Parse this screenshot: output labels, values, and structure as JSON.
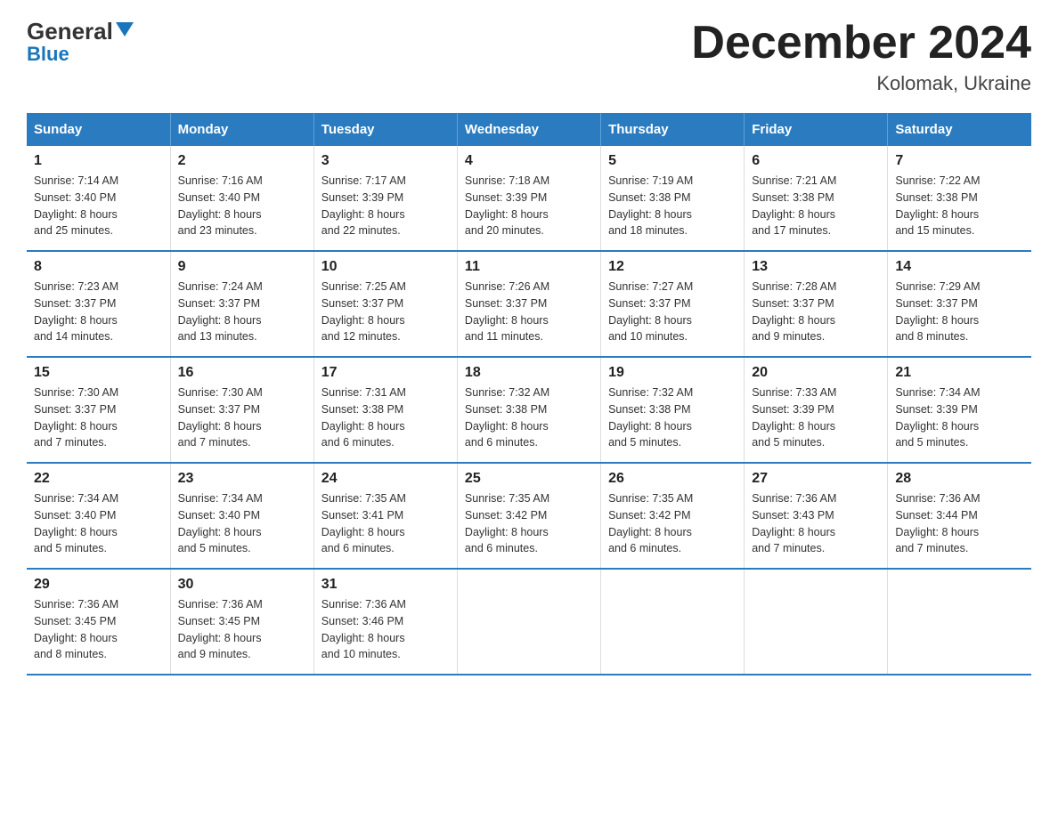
{
  "logo": {
    "text1": "General",
    "text2": "Blue"
  },
  "title": "December 2024",
  "subtitle": "Kolomak, Ukraine",
  "weekdays": [
    "Sunday",
    "Monday",
    "Tuesday",
    "Wednesday",
    "Thursday",
    "Friday",
    "Saturday"
  ],
  "weeks": [
    [
      {
        "day": "1",
        "sunrise": "7:14 AM",
        "sunset": "3:40 PM",
        "daylight": "8 hours and 25 minutes."
      },
      {
        "day": "2",
        "sunrise": "7:16 AM",
        "sunset": "3:40 PM",
        "daylight": "8 hours and 23 minutes."
      },
      {
        "day": "3",
        "sunrise": "7:17 AM",
        "sunset": "3:39 PM",
        "daylight": "8 hours and 22 minutes."
      },
      {
        "day": "4",
        "sunrise": "7:18 AM",
        "sunset": "3:39 PM",
        "daylight": "8 hours and 20 minutes."
      },
      {
        "day": "5",
        "sunrise": "7:19 AM",
        "sunset": "3:38 PM",
        "daylight": "8 hours and 18 minutes."
      },
      {
        "day": "6",
        "sunrise": "7:21 AM",
        "sunset": "3:38 PM",
        "daylight": "8 hours and 17 minutes."
      },
      {
        "day": "7",
        "sunrise": "7:22 AM",
        "sunset": "3:38 PM",
        "daylight": "8 hours and 15 minutes."
      }
    ],
    [
      {
        "day": "8",
        "sunrise": "7:23 AM",
        "sunset": "3:37 PM",
        "daylight": "8 hours and 14 minutes."
      },
      {
        "day": "9",
        "sunrise": "7:24 AM",
        "sunset": "3:37 PM",
        "daylight": "8 hours and 13 minutes."
      },
      {
        "day": "10",
        "sunrise": "7:25 AM",
        "sunset": "3:37 PM",
        "daylight": "8 hours and 12 minutes."
      },
      {
        "day": "11",
        "sunrise": "7:26 AM",
        "sunset": "3:37 PM",
        "daylight": "8 hours and 11 minutes."
      },
      {
        "day": "12",
        "sunrise": "7:27 AM",
        "sunset": "3:37 PM",
        "daylight": "8 hours and 10 minutes."
      },
      {
        "day": "13",
        "sunrise": "7:28 AM",
        "sunset": "3:37 PM",
        "daylight": "8 hours and 9 minutes."
      },
      {
        "day": "14",
        "sunrise": "7:29 AM",
        "sunset": "3:37 PM",
        "daylight": "8 hours and 8 minutes."
      }
    ],
    [
      {
        "day": "15",
        "sunrise": "7:30 AM",
        "sunset": "3:37 PM",
        "daylight": "8 hours and 7 minutes."
      },
      {
        "day": "16",
        "sunrise": "7:30 AM",
        "sunset": "3:37 PM",
        "daylight": "8 hours and 7 minutes."
      },
      {
        "day": "17",
        "sunrise": "7:31 AM",
        "sunset": "3:38 PM",
        "daylight": "8 hours and 6 minutes."
      },
      {
        "day": "18",
        "sunrise": "7:32 AM",
        "sunset": "3:38 PM",
        "daylight": "8 hours and 6 minutes."
      },
      {
        "day": "19",
        "sunrise": "7:32 AM",
        "sunset": "3:38 PM",
        "daylight": "8 hours and 5 minutes."
      },
      {
        "day": "20",
        "sunrise": "7:33 AM",
        "sunset": "3:39 PM",
        "daylight": "8 hours and 5 minutes."
      },
      {
        "day": "21",
        "sunrise": "7:34 AM",
        "sunset": "3:39 PM",
        "daylight": "8 hours and 5 minutes."
      }
    ],
    [
      {
        "day": "22",
        "sunrise": "7:34 AM",
        "sunset": "3:40 PM",
        "daylight": "8 hours and 5 minutes."
      },
      {
        "day": "23",
        "sunrise": "7:34 AM",
        "sunset": "3:40 PM",
        "daylight": "8 hours and 5 minutes."
      },
      {
        "day": "24",
        "sunrise": "7:35 AM",
        "sunset": "3:41 PM",
        "daylight": "8 hours and 6 minutes."
      },
      {
        "day": "25",
        "sunrise": "7:35 AM",
        "sunset": "3:42 PM",
        "daylight": "8 hours and 6 minutes."
      },
      {
        "day": "26",
        "sunrise": "7:35 AM",
        "sunset": "3:42 PM",
        "daylight": "8 hours and 6 minutes."
      },
      {
        "day": "27",
        "sunrise": "7:36 AM",
        "sunset": "3:43 PM",
        "daylight": "8 hours and 7 minutes."
      },
      {
        "day": "28",
        "sunrise": "7:36 AM",
        "sunset": "3:44 PM",
        "daylight": "8 hours and 7 minutes."
      }
    ],
    [
      {
        "day": "29",
        "sunrise": "7:36 AM",
        "sunset": "3:45 PM",
        "daylight": "8 hours and 8 minutes."
      },
      {
        "day": "30",
        "sunrise": "7:36 AM",
        "sunset": "3:45 PM",
        "daylight": "8 hours and 9 minutes."
      },
      {
        "day": "31",
        "sunrise": "7:36 AM",
        "sunset": "3:46 PM",
        "daylight": "8 hours and 10 minutes."
      },
      null,
      null,
      null,
      null
    ]
  ],
  "labels": {
    "sunrise": "Sunrise:",
    "sunset": "Sunset:",
    "daylight": "Daylight:"
  }
}
